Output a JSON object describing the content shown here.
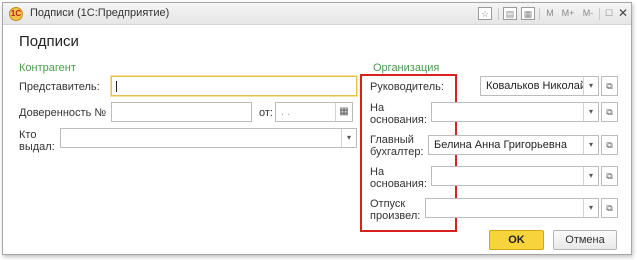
{
  "window": {
    "title": "Подписи  (1С:Предприятие)",
    "icon": "1c-logo-icon",
    "toolbar": {
      "m": "M",
      "m_plus": "M+",
      "m_minus": "M-"
    }
  },
  "form": {
    "title": "Подписи"
  },
  "kontragent": {
    "heading": "Контрагент",
    "representative_label": "Представитель:",
    "representative_value": "",
    "power_of_attorney_label": "Доверенность №",
    "power_of_attorney_value": "",
    "from_label": "от:",
    "date_placeholder": " .  .",
    "issued_by_label": "Кто\nвыдал:",
    "issued_by_value": ""
  },
  "organization": {
    "heading": "Организация",
    "manager_label": "Руководитель:",
    "manager_value": "Ковальков  Николай",
    "basis1_label": "На\nоснования:",
    "basis1_value": "",
    "chief_accountant_label": "Главный\nбухгалтер:",
    "chief_accountant_value": "Белина Анна  Григорьевна",
    "basis2_label": "На\nоснования:",
    "basis2_value": "",
    "released_by_label": "Отпуск\nпроизвел:",
    "released_by_value": ""
  },
  "buttons": {
    "ok": "OK",
    "cancel": "Отмена"
  },
  "colors": {
    "section_heading": "#4c9a4c",
    "highlight_box": "#d92020",
    "ok_button": "#f7d33c",
    "focus_border": "#e8c04a"
  }
}
